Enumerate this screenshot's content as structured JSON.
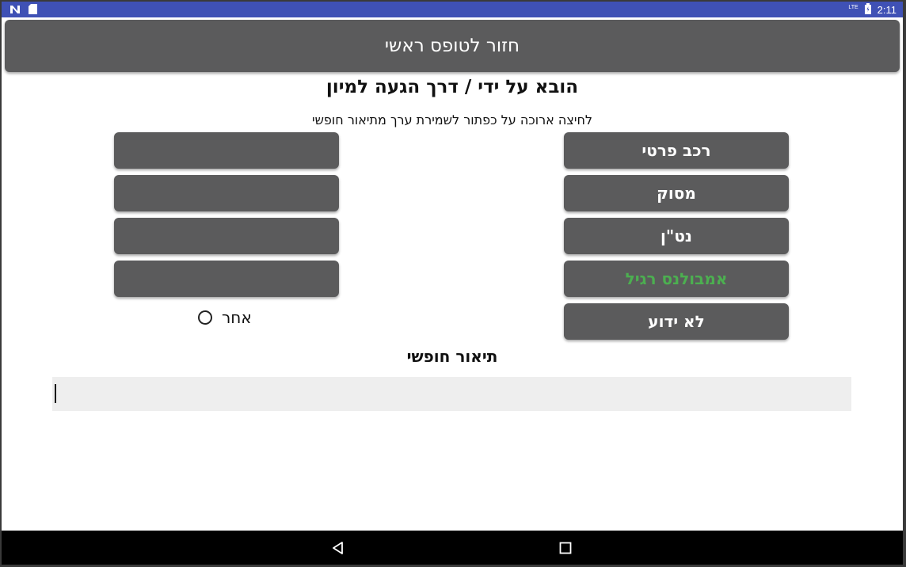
{
  "status_bar": {
    "left_icons": [
      "n-notification-icon",
      "sd-card-icon"
    ],
    "network": "LTE",
    "time": "2:11"
  },
  "header": {
    "back_button_label": "חזור לטופס ראשי"
  },
  "title": "הובא על ידי / דרך הגעה למיון",
  "hint": "לחיצה ארוכה על כפתור לשמירת ערך מתיאור חופשי",
  "right_options": [
    {
      "label": "רכב פרטי",
      "selected": false
    },
    {
      "label": "מסוק",
      "selected": false
    },
    {
      "label": "נט\"ן",
      "selected": false
    },
    {
      "label": "אמבולנס רגיל",
      "selected": true
    },
    {
      "label": "לא ידוע",
      "selected": false
    }
  ],
  "left_options": [
    {
      "label": ""
    },
    {
      "label": ""
    },
    {
      "label": ""
    },
    {
      "label": ""
    }
  ],
  "other_radio": {
    "label": "אחר",
    "checked": false
  },
  "free_text": {
    "title": "תיאור חופשי",
    "value": ""
  },
  "colors": {
    "status_bar": "#3f51b5",
    "button_bg": "#5b5b5c",
    "selected_text": "#4caf50",
    "input_bg": "#eeeeee"
  },
  "nav_bar": {
    "icons": [
      "back-triangle-icon",
      "home-square-icon"
    ]
  }
}
